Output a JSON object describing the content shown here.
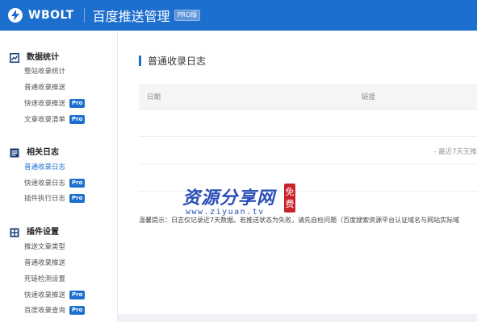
{
  "header": {
    "brand": "WBOLT",
    "title": "百度推送管理",
    "version_badge": "PRO版",
    "brand_color": "#1c6fcf"
  },
  "sidebar": {
    "groups": [
      {
        "label": "数据统计",
        "icon": "chart-icon",
        "items": [
          {
            "label": "整站收录统计",
            "pro": false,
            "active": false
          },
          {
            "label": "普通收录推送",
            "pro": false,
            "active": false
          },
          {
            "label": "快速收录推送",
            "pro": true,
            "active": false
          },
          {
            "label": "文章收录清单",
            "pro": true,
            "active": false
          }
        ]
      },
      {
        "label": "相关日志",
        "icon": "document-icon",
        "items": [
          {
            "label": "普通收录日志",
            "pro": false,
            "active": true
          },
          {
            "label": "快速收录日志",
            "pro": true,
            "active": false
          },
          {
            "label": "插件执行日志",
            "pro": true,
            "active": false
          }
        ]
      },
      {
        "label": "插件设置",
        "icon": "settings-grid-icon",
        "items": [
          {
            "label": "推送文章类型",
            "pro": false,
            "active": false
          },
          {
            "label": "普通收录推送",
            "pro": false,
            "active": false
          },
          {
            "label": "死链检测设置",
            "pro": false,
            "active": false
          },
          {
            "label": "快速收录推送",
            "pro": true,
            "active": false
          },
          {
            "label": "百度收录查询",
            "pro": true,
            "active": false
          }
        ]
      }
    ],
    "pro_label": "Pro"
  },
  "main": {
    "section_title": "普通收录日志",
    "table": {
      "columns": [
        "日期",
        "链接"
      ],
      "empty_text": "- 最近7天无推"
    },
    "tip": "温馨提示：日志仅记录近7天数据。若推送状态为失败，请先自检问题（百度搜索资源平台认证域名与网站实际域"
  },
  "watermark": {
    "title": "资源分享网",
    "url": "www.ziyuan.tv",
    "seal": "免费"
  }
}
